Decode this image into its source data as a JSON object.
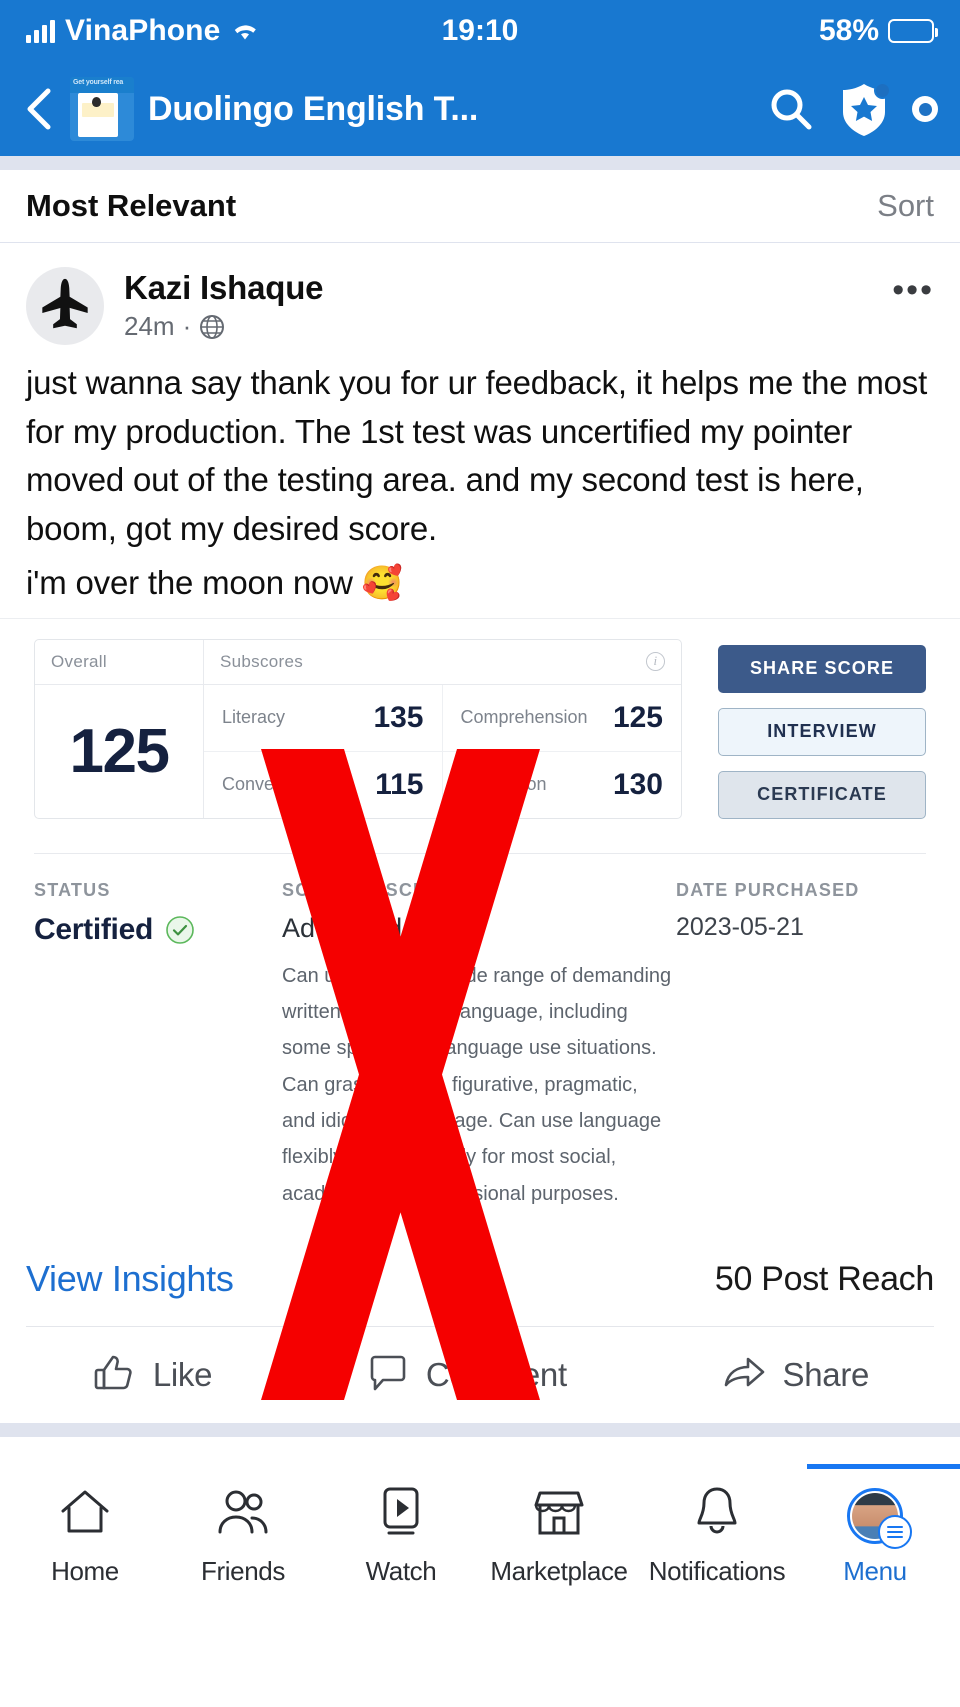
{
  "statusbar": {
    "carrier": "VinaPhone",
    "time": "19:10",
    "battery": "58%",
    "signal_icon": "cellular-bars-icon",
    "wifi_icon": "wifi-icon",
    "battery_icon": "battery-icon"
  },
  "appbar": {
    "back_icon": "back-chevron-icon",
    "page_thumb_icon": "page-thumbnail-icon",
    "title": "Duolingo English T...",
    "search_icon": "search-icon",
    "shield_icon": "shield-star-icon",
    "more_icon": "more-options-icon"
  },
  "sortbar": {
    "label": "Most Relevant",
    "sort": "Sort"
  },
  "post": {
    "avatar_icon": "airplane-avatar-icon",
    "author": "Kazi Ishaque",
    "time": "24m",
    "separator": "·",
    "audience_icon": "globe-icon",
    "more_icon": "post-more-icon",
    "body_line1": "just wanna say thank you for ur feedback, it helps me the most for my production. The 1st test was uncertified my pointer moved out of the testing area. and my second test is here, boom, got my desired score.",
    "body_line2": "i'm over the moon now 🥰"
  },
  "scorecard": {
    "overall_header": "Overall",
    "subscores_header": "Subscores",
    "info_icon": "info-icon",
    "overall_value": "125",
    "subscores": [
      {
        "name": "Literacy",
        "value": "135"
      },
      {
        "name": "Comprehension",
        "value": "125"
      },
      {
        "name": "Conversation",
        "value": "115"
      },
      {
        "name": "Production",
        "value": "130"
      }
    ],
    "buttons": {
      "share": "SHARE SCORE",
      "interview": "INTERVIEW",
      "certificate": "CERTIFICATE"
    },
    "status_kicker": "STATUS",
    "status_value": "Certified",
    "status_check_icon": "check-circle-icon",
    "score_desc_kicker": "SCORE DESCRIPTION",
    "score_desc_level": "Advanced",
    "score_desc_text": "Can understand a wide range of demanding written and spoken language, including some specialized language use situations. Can grasp implicit, figurative, pragmatic, and idiomatic language. Can use language flexibly and effectively for most social, academic, and professional purposes.",
    "date_kicker": "DATE PURCHASED",
    "date_value": "2023-05-21",
    "overlay_mark": "red-x-overlay",
    "colors": {
      "primary_button": "#3c5a8a",
      "score_navy": "#15213f",
      "overlay_red": "#f50000"
    }
  },
  "insights": {
    "link": "View Insights",
    "reach": "50 Post Reach"
  },
  "actions": [
    {
      "label": "Like",
      "icon": "thumbs-up-icon"
    },
    {
      "label": "Comment",
      "icon": "comment-bubble-icon"
    },
    {
      "label": "Share",
      "icon": "share-arrow-icon"
    }
  ],
  "bottomnav": [
    {
      "label": "Home",
      "icon": "home-icon",
      "active": false
    },
    {
      "label": "Friends",
      "icon": "friends-icon",
      "active": false
    },
    {
      "label": "Watch",
      "icon": "watch-video-icon",
      "active": false
    },
    {
      "label": "Marketplace",
      "icon": "marketplace-store-icon",
      "active": false
    },
    {
      "label": "Notifications",
      "icon": "notifications-bell-icon",
      "active": false
    },
    {
      "label": "Menu",
      "icon": "menu-avatar-icon",
      "active": true
    }
  ]
}
